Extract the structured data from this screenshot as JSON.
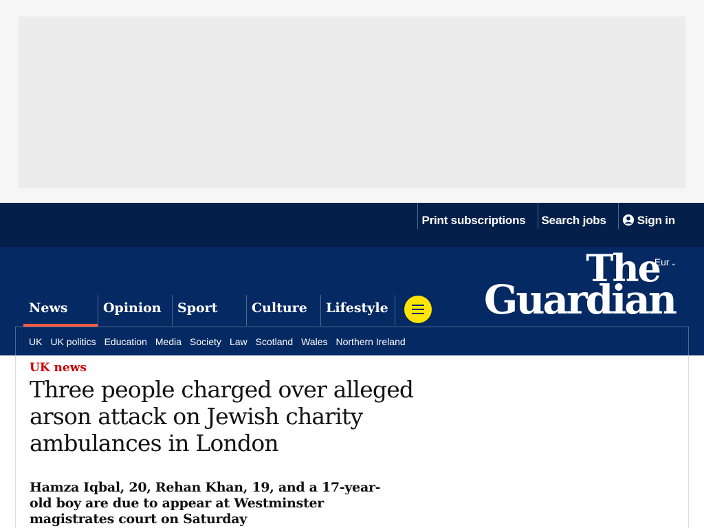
{
  "topbar": {
    "links": [
      "Print subscriptions",
      "Search jobs",
      "Sign in"
    ]
  },
  "masthead": {
    "edition": "Eur",
    "logo_line1": "The",
    "logo_line2": "Guardian",
    "pillars": [
      {
        "label": "News",
        "active": true
      },
      {
        "label": "Opinion",
        "active": false
      },
      {
        "label": "Sport",
        "active": false
      },
      {
        "label": "Culture",
        "active": false
      },
      {
        "label": "Lifestyle",
        "active": false
      }
    ],
    "menu_icon": "hamburger-icon",
    "subnav": [
      "UK",
      "UK politics",
      "Education",
      "Media",
      "Society",
      "Law",
      "Scotland",
      "Wales",
      "Northern Ireland"
    ]
  },
  "article": {
    "kicker": "UK news",
    "headline": "Three people charged over alleged arson attack on Jewish charity ambulances in London",
    "standfirst": "Hamza Iqbal, 20, Rehan Khan, 19, and a 17-year-old boy are due to appear at Westminster magistrates court on Saturday"
  },
  "colors": {
    "brand_dark": "#041f4a",
    "brand": "#052962",
    "accent_yellow": "#ffe500",
    "news_red": "#c70000",
    "active_underline": "#ff5943"
  }
}
